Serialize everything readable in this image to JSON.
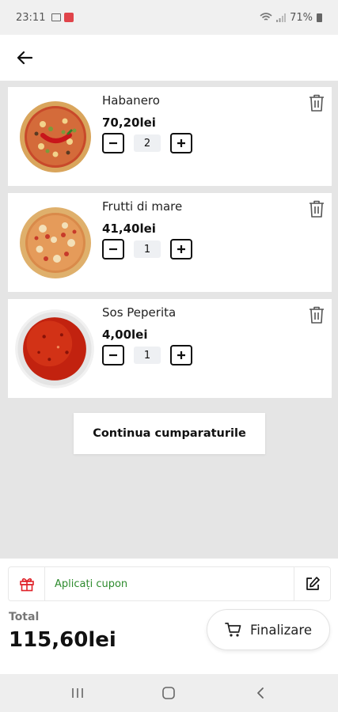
{
  "status_bar": {
    "time": "23:11",
    "battery": "71%"
  },
  "app_bar": {
    "back_icon": "arrow-left-icon"
  },
  "cart": {
    "items": [
      {
        "name": "Habanero",
        "price": "70,20lei",
        "quantity": "2",
        "image": "pizza-habanero"
      },
      {
        "name": "Frutti di mare",
        "price": "41,40lei",
        "quantity": "1",
        "image": "pizza-frutti-di-mare"
      },
      {
        "name": "Sos Peperita",
        "price": "4,00lei",
        "quantity": "1",
        "image": "sauce-bowl"
      }
    ]
  },
  "continue_label": "Continua cumparaturile",
  "coupon": {
    "label": "Aplicați cupon"
  },
  "total": {
    "label": "Total",
    "value": "115,60lei"
  },
  "checkout_label": "Finalizare",
  "colors": {
    "coupon_green": "#2e8b2e",
    "gift_red": "#e0232a",
    "background": "#e5e5e5"
  }
}
